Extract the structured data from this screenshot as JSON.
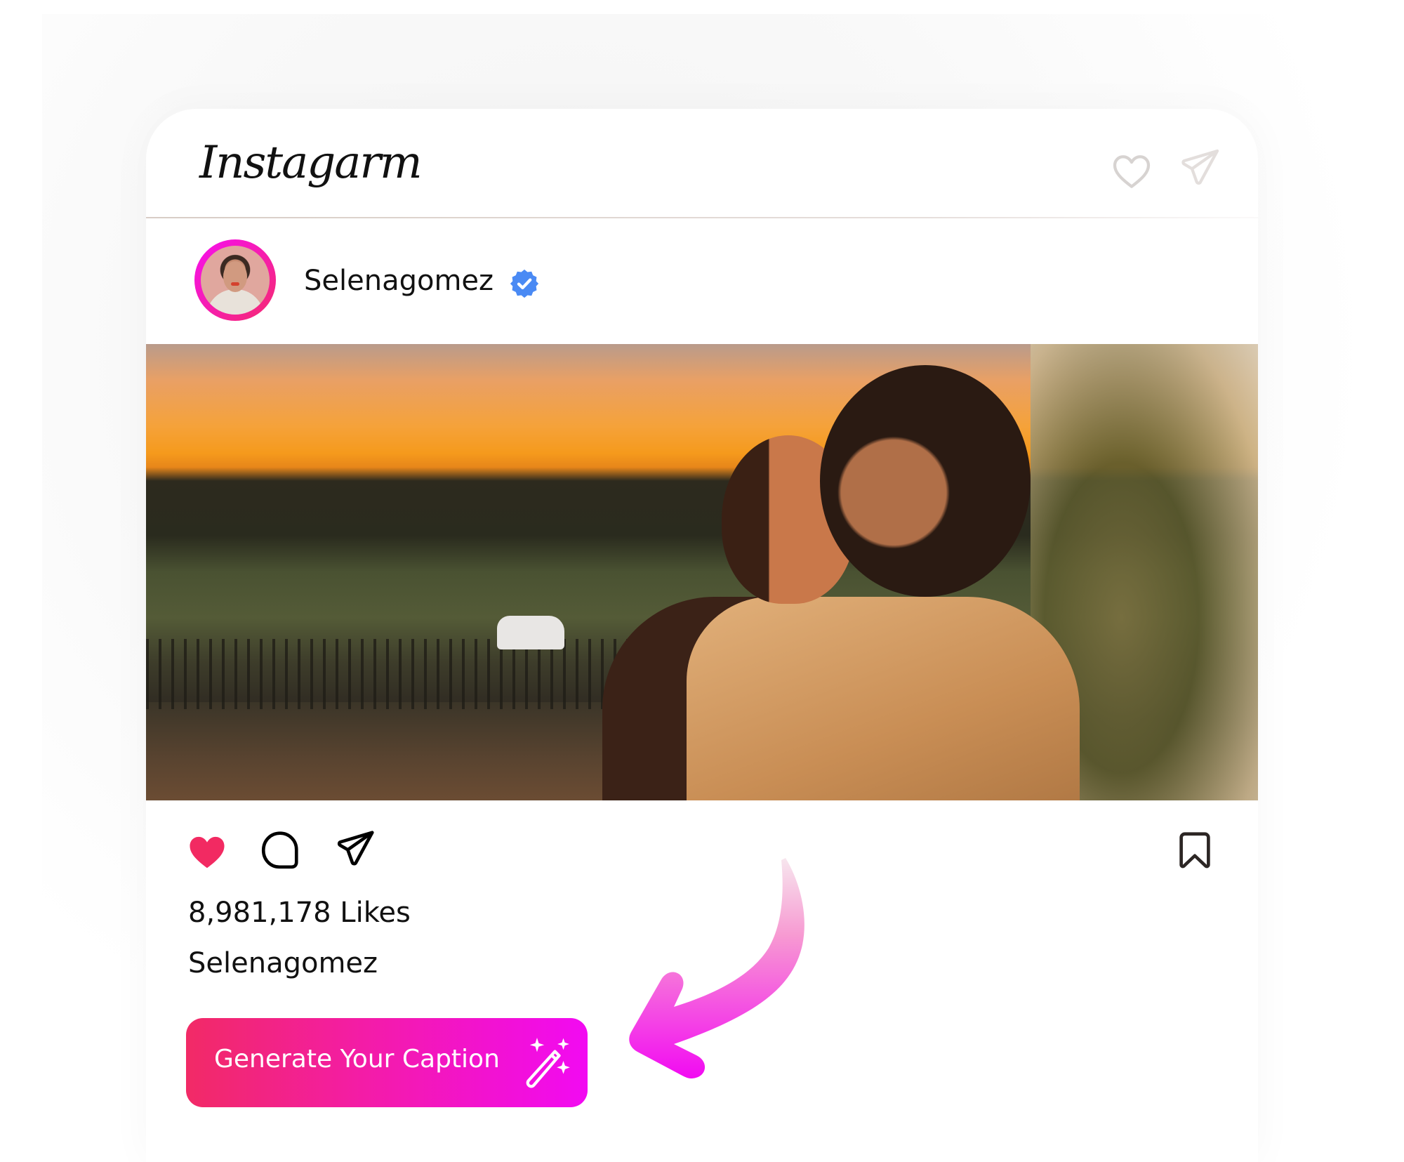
{
  "app": {
    "logo_text": "Instagarm"
  },
  "header": {
    "icons": [
      "heart-outline-icon",
      "send-icon"
    ]
  },
  "post": {
    "username": "Selenagomez",
    "verified": true,
    "avatar_alt": "Selena Gomez profile photo",
    "photo_alt": "Couple embracing at sunset",
    "liked": true,
    "likes_text": "8,981,178 Likes",
    "caption_username": "Selenagomez"
  },
  "actions": {
    "icons": [
      "heart-filled-icon",
      "comment-icon",
      "send-icon",
      "bookmark-icon"
    ]
  },
  "cta": {
    "label": "Generate Your Caption",
    "icon": "magic-wand-icon"
  },
  "colors": {
    "like_red": "#f22a62",
    "verified_blue": "#4a8af4",
    "cta_gradient_start": "#f22a66",
    "cta_gradient_end": "#f20af2",
    "header_icon_gray": "#d7d3d1"
  }
}
